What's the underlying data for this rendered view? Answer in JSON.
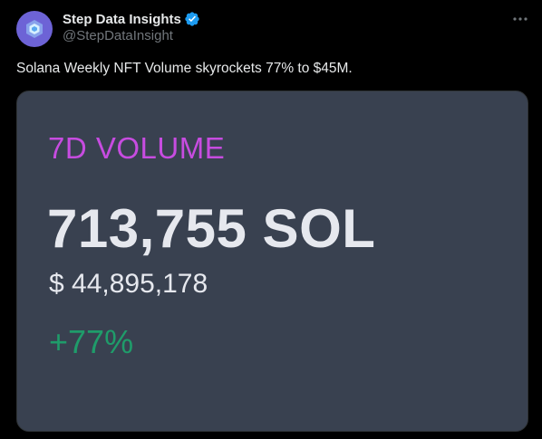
{
  "author": {
    "display_name": "Step Data Insights",
    "handle": "@StepDataInsight",
    "verified": true,
    "avatar_icon": "step-logo-icon",
    "avatar_color": "#6d63d6"
  },
  "tweet": {
    "text": "Solana Weekly NFT Volume skyrockets 77% to $45M."
  },
  "card": {
    "label": "7D VOLUME",
    "volume_sol": "713,755 SOL",
    "volume_usd": "$ 44,895,178",
    "change": "+77%",
    "background_color": "#394150",
    "label_color": "#c74ce0",
    "change_color": "#1f9c6a"
  },
  "icons": {
    "verified": "verified-badge-icon",
    "more": "more-options-icon"
  }
}
